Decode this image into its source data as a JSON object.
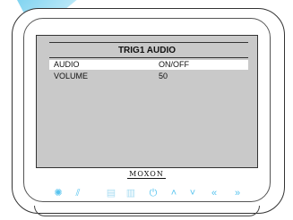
{
  "screen": {
    "title": "TRIG1 AUDIO",
    "rows": [
      {
        "label": "AUDIO",
        "value": "ON/OFF",
        "selected": true
      },
      {
        "label": "VOLUME",
        "value": "50",
        "selected": false
      }
    ]
  },
  "brand": "MOXON",
  "buttons": [
    {
      "name": "light-icon",
      "glyph": "✺"
    },
    {
      "name": "wipe-icon",
      "glyph": "⫽"
    },
    {
      "name": "menu-icon",
      "glyph": "▤"
    },
    {
      "name": "mode-icon",
      "glyph": "▥"
    },
    {
      "name": "power-icon",
      "glyph": "⏻"
    },
    {
      "name": "up-icon",
      "glyph": "˄"
    },
    {
      "name": "down-icon",
      "glyph": "˅"
    },
    {
      "name": "left-icon",
      "glyph": "«"
    },
    {
      "name": "right-icon",
      "glyph": "»"
    }
  ],
  "colors": {
    "button_accent": "#58c4ef",
    "screen_bg": "#c9c9c9"
  }
}
